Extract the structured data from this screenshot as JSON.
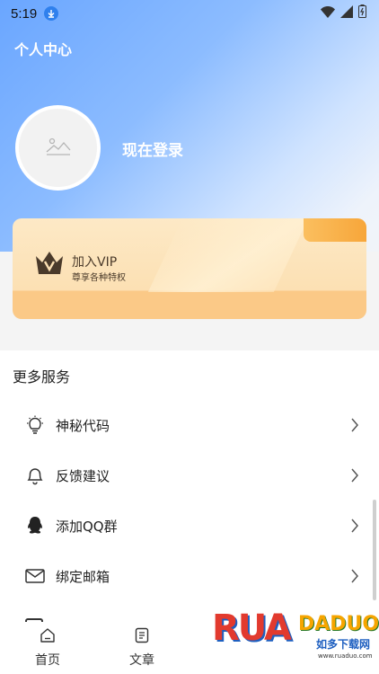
{
  "status_bar": {
    "time": "5:19"
  },
  "header": {
    "title": "个人中心",
    "login_text": "现在登录"
  },
  "vip_card": {
    "title": "加入VIP",
    "subtitle": "尊享各种特权"
  },
  "services": {
    "section_title": "更多服务",
    "items": [
      {
        "label": "神秘代码",
        "icon": "lightbulb-icon"
      },
      {
        "label": "反馈建议",
        "icon": "bell-icon"
      },
      {
        "label": "添加QQ群",
        "icon": "qq-icon"
      },
      {
        "label": "绑定邮箱",
        "icon": "mail-icon"
      }
    ]
  },
  "tabbar": {
    "tabs": [
      {
        "label": "首页",
        "icon": "home-icon"
      },
      {
        "label": "文章",
        "icon": "article-icon"
      }
    ]
  },
  "watermark": {
    "logo": "RUADADUO",
    "text": "如多下载网",
    "url": "www.ruaduo.com"
  },
  "colors": {
    "accent_blue": "#6aa6ff",
    "vip_gold": "#fce0b3",
    "vip_corner": "#f7a63a"
  }
}
